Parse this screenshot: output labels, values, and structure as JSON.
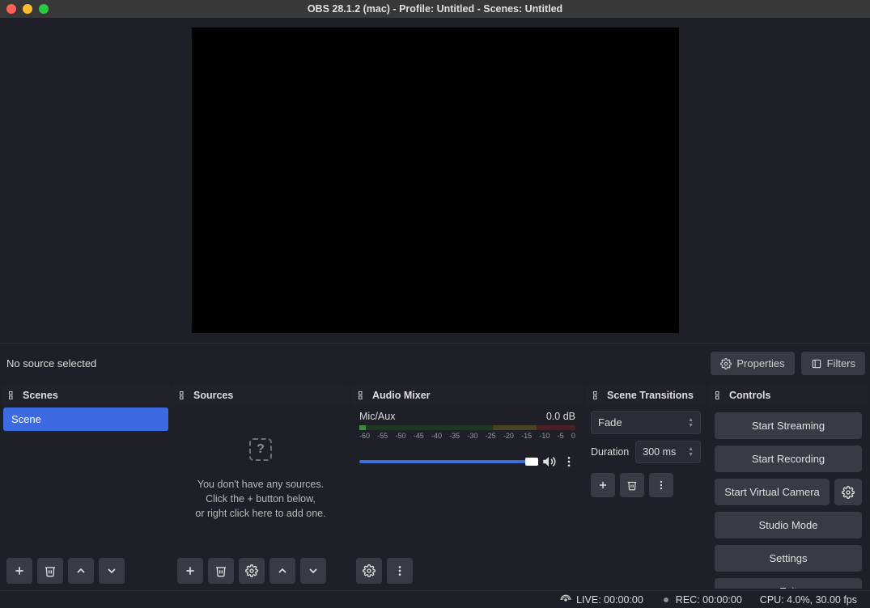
{
  "window": {
    "title": "OBS 28.1.2 (mac) - Profile: Untitled - Scenes: Untitled"
  },
  "toolbar": {
    "no_source": "No source selected",
    "properties": "Properties",
    "filters": "Filters"
  },
  "docks": {
    "scenes": {
      "title": "Scenes",
      "items": [
        "Scene"
      ]
    },
    "sources": {
      "title": "Sources",
      "empty_line1": "You don't have any sources.",
      "empty_line2": "Click the + button below,",
      "empty_line3": "or right click here to add one."
    },
    "mixer": {
      "title": "Audio Mixer",
      "channel_name": "Mic/Aux",
      "channel_level": "0.0 dB",
      "ticks": [
        "-60",
        "-55",
        "-50",
        "-45",
        "-40",
        "-35",
        "-30",
        "-25",
        "-20",
        "-15",
        "-10",
        "-5",
        "0"
      ]
    },
    "transitions": {
      "title": "Scene Transitions",
      "selected": "Fade",
      "duration_label": "Duration",
      "duration_value": "300 ms"
    },
    "controls": {
      "title": "Controls",
      "start_streaming": "Start Streaming",
      "start_recording": "Start Recording",
      "start_virtual_camera": "Start Virtual Camera",
      "studio_mode": "Studio Mode",
      "settings": "Settings",
      "exit": "Exit"
    }
  },
  "statusbar": {
    "live": "LIVE: 00:00:00",
    "rec": "REC: 00:00:00",
    "cpu": "CPU: 4.0%, 30.00 fps"
  }
}
